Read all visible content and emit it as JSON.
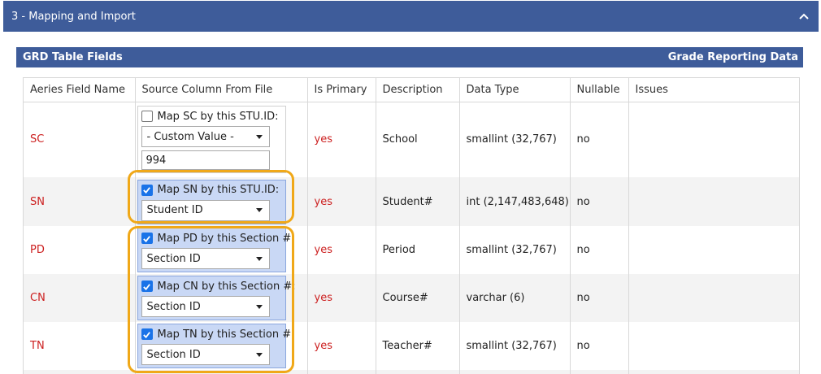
{
  "section": {
    "title": "3 - Mapping and Import"
  },
  "panel": {
    "title": "GRD Table Fields",
    "subtitle": "Grade Reporting Data"
  },
  "columns": [
    "Aeries Field Name",
    "Source Column From File",
    "Is Primary",
    "Description",
    "Data Type",
    "Nullable",
    "Issues"
  ],
  "rows": [
    {
      "field": "SC",
      "map_label": "Map SC by this STU.ID:",
      "checked": false,
      "select": "- Custom Value -",
      "custom_value": "994",
      "primary": "yes",
      "description": "School",
      "datatype": "smallint (32,767)",
      "nullable": "no",
      "issues": ""
    },
    {
      "field": "SN",
      "map_label": "Map SN by this STU.ID:",
      "checked": true,
      "select": "Student ID",
      "primary": "yes",
      "description": "Student#",
      "datatype": "int (2,147,483,648)",
      "nullable": "no",
      "issues": ""
    },
    {
      "field": "PD",
      "map_label": "Map PD by this Section #:",
      "checked": true,
      "select": "Section ID",
      "primary": "yes",
      "description": "Period",
      "datatype": "smallint (32,767)",
      "nullable": "no",
      "issues": ""
    },
    {
      "field": "CN",
      "map_label": "Map CN by this Section #:",
      "checked": true,
      "select": "Section ID",
      "primary": "yes",
      "description": "Course#",
      "datatype": "varchar (6)",
      "nullable": "no",
      "issues": ""
    },
    {
      "field": "TN",
      "map_label": "Map TN by this Section #:",
      "checked": true,
      "select": "Section ID",
      "primary": "yes",
      "description": "Teacher#",
      "datatype": "smallint (32,767)",
      "nullable": "no",
      "issues": ""
    }
  ],
  "icons": {
    "collapse": "chevron-up-icon",
    "check": "checkmark-icon",
    "dropdown": "dropdown-arrow-icon"
  },
  "colors": {
    "header_bg": "#3e5c9a",
    "field_red": "#cc1f1f",
    "checked_bg": "#c9d8f5",
    "highlight": "#f0a818",
    "checkbox": "#1a73e8"
  }
}
